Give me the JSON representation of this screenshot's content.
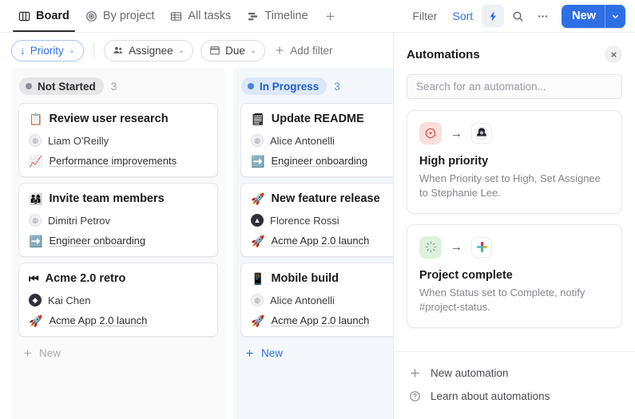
{
  "topbar": {
    "tabs": [
      {
        "label": "Board",
        "icon": "board-columns-icon",
        "active": true
      },
      {
        "label": "By project",
        "icon": "target-icon",
        "active": false
      },
      {
        "label": "All tasks",
        "icon": "table-grid-icon",
        "active": false
      },
      {
        "label": "Timeline",
        "icon": "timeline-gantt-icon",
        "active": false
      }
    ],
    "add_tab": "+",
    "filter_label": "Filter",
    "sort_label": "Sort",
    "bolt_icon": "lightning-bolt-icon",
    "search_icon": "search-icon",
    "more_icon": "more-horizontal-icon",
    "new_label": "New",
    "new_caret": "chevron-down-icon",
    "accent_color": "#2f6fe4"
  },
  "filterbar": {
    "priority": {
      "label": "Priority",
      "prefix": "↓",
      "caret": "⌄"
    },
    "assignee": {
      "label": "Assignee",
      "icon": "people-icon",
      "caret": "⌄"
    },
    "due": {
      "label": "Due",
      "icon": "calendar-icon",
      "caret": "⌄"
    },
    "add_filter": "Add filter"
  },
  "board": {
    "columns": [
      {
        "status": "Not Started",
        "count": "3",
        "tone": "gray",
        "new_label": "New",
        "cards": [
          {
            "title": "Review user research",
            "title_emoji": "📋",
            "assignee": "Liam O'Reilly",
            "project": "Performance improvements",
            "project_emoji": "📈"
          },
          {
            "title": "Invite team members",
            "title_emoji": "👨‍👩‍👧",
            "assignee": "Dimitri Petrov",
            "project": "Engineer onboarding",
            "project_emoji": "➡️"
          },
          {
            "title": "Acme 2.0 retro",
            "title_emoji": "⏮",
            "assignee": "Kai Chen",
            "project": "Acme App 2.0 launch",
            "project_emoji": "🚀"
          }
        ]
      },
      {
        "status": "In Progress",
        "count": "3",
        "tone": "blue",
        "new_label": "New",
        "cards": [
          {
            "title": "Update README",
            "title_emoji": "🗒",
            "assignee": "Alice Antonelli",
            "project": "Engineer onboarding",
            "project_emoji": "➡️"
          },
          {
            "title": "New feature release",
            "title_emoji": "🚀",
            "assignee": "Florence Rossi",
            "project": "Acme App 2.0 launch",
            "project_emoji": "🚀"
          },
          {
            "title": "Mobile build",
            "title_emoji": "📱",
            "assignee": "Alice Antonelli",
            "project": "Acme App 2.0 launch",
            "project_emoji": "🚀"
          }
        ]
      }
    ]
  },
  "panel": {
    "title": "Automations",
    "close_icon": "close-icon",
    "search_placeholder": "Search for an automation...",
    "automations": [
      {
        "name": "High priority",
        "description": "When Priority set to High, Set Assignee to Stephanie Lee.",
        "trigger_icon": "priority-arrow-down-icon",
        "trigger_tone": "pink",
        "action_icon": "user-avatar-icon"
      },
      {
        "name": "Project complete",
        "description": "When Status set to Complete, notify #project-status.",
        "trigger_icon": "sparkle-complete-icon",
        "trigger_tone": "green",
        "action_icon": "slack-logo-icon"
      }
    ],
    "footer": [
      {
        "label": "New automation",
        "icon": "plus-icon"
      },
      {
        "label": "Learn about automations",
        "icon": "question-circle-icon"
      }
    ]
  }
}
